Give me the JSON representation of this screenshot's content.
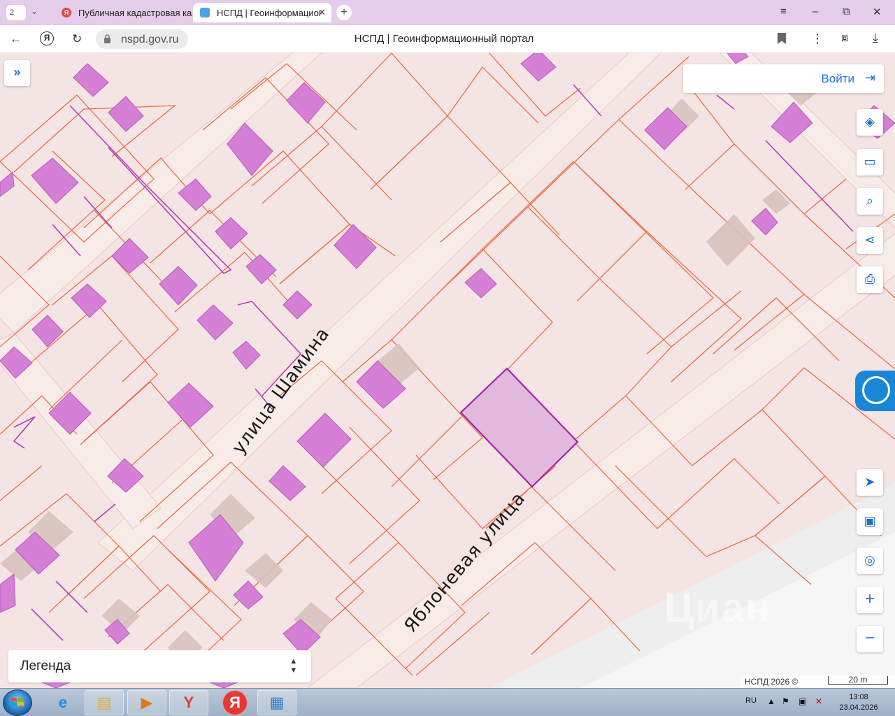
{
  "browser": {
    "tab_count": "2",
    "tabs": [
      {
        "title": "Публичная кадастровая карт",
        "favicon": "yandex-icon"
      },
      {
        "title": "НСПД | Геоинформационный портал",
        "favicon": "nspd-icon",
        "active": true
      }
    ],
    "new_tab": "+",
    "window_controls": {
      "menu": "≡",
      "minimize": "–",
      "restore": "⧉",
      "close": "✕"
    },
    "address": {
      "domain": "nspd.gov.ru",
      "page_title": "НСПД | Геоинформационный портал"
    },
    "yandex_button": "Я"
  },
  "map": {
    "street_labels": [
      "улица Шамина",
      "Яблоневая улица"
    ],
    "login": {
      "label": "Войти",
      "icon": "login-icon"
    },
    "panel_toggle": "»",
    "tools": [
      {
        "name": "layers-icon",
        "glyph": "◈"
      },
      {
        "name": "ruler-icon",
        "glyph": "▭"
      },
      {
        "name": "area-search-icon",
        "glyph": "⌕"
      },
      {
        "name": "share-icon",
        "glyph": "⋖"
      },
      {
        "name": "print-icon",
        "glyph": "⎙"
      },
      {
        "name": "navigate-icon",
        "glyph": "➤"
      },
      {
        "name": "minimap-icon",
        "glyph": "▣"
      },
      {
        "name": "locate-icon",
        "glyph": "◎"
      },
      {
        "name": "zoom-in-icon",
        "glyph": "+"
      },
      {
        "name": "zoom-out-icon",
        "glyph": "−"
      }
    ],
    "legend": {
      "label": "Легенда",
      "chevron_up": "▴",
      "chevron_down": "▾"
    },
    "attribution": "НСПД 2026 ©",
    "scale": "20 m",
    "watermark": "Циан",
    "colors": {
      "parcel_border": "#e8693e",
      "building_fill": "#d57fd7",
      "selected_parcel": "#a126a7",
      "road": "#f7e3e1"
    }
  },
  "taskbar": {
    "apps": [
      "ie-icon",
      "explorer-icon",
      "media-player-icon",
      "yandex-browser-icon",
      "yandex-icon",
      "photo-viewer-icon"
    ],
    "language": "RU",
    "time": "13:08",
    "date": "23.04.2026"
  }
}
